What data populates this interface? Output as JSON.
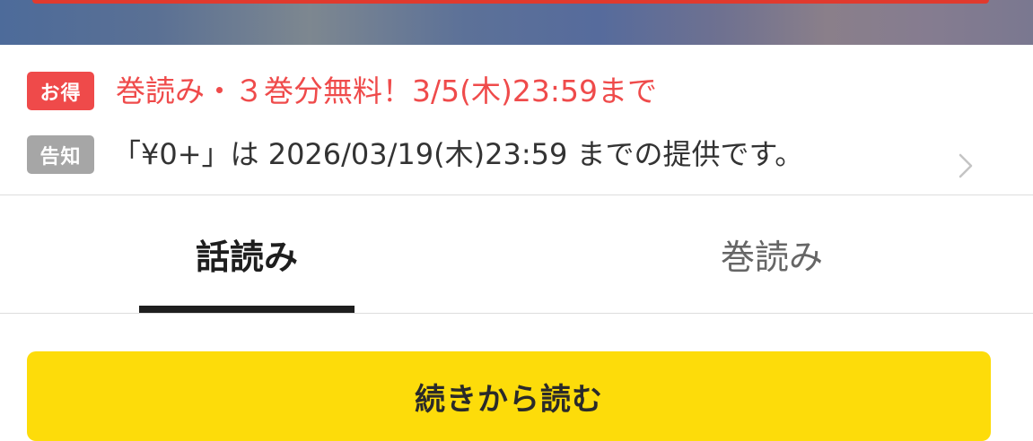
{
  "banner": {
    "accent_color": "#e03a2e"
  },
  "notice": {
    "deal_tag": "お得",
    "deal_text": "巻読み・３巻分無料！3/5(木)23:59まで",
    "info_tag": "告知",
    "info_text": "「¥0+」は 2026/03/19(木)23:59 までの提供です。",
    "chevron_icon": "chevron-right-icon",
    "colors": {
      "deal": "#ef4a4a",
      "info_tag": "#a6a6a6"
    }
  },
  "tabs": {
    "items": [
      {
        "label": "話読み",
        "selected": true
      },
      {
        "label": "巻読み",
        "selected": false
      }
    ]
  },
  "actions": {
    "continue_label": "続きから読む",
    "button_color": "#fddc0a"
  }
}
